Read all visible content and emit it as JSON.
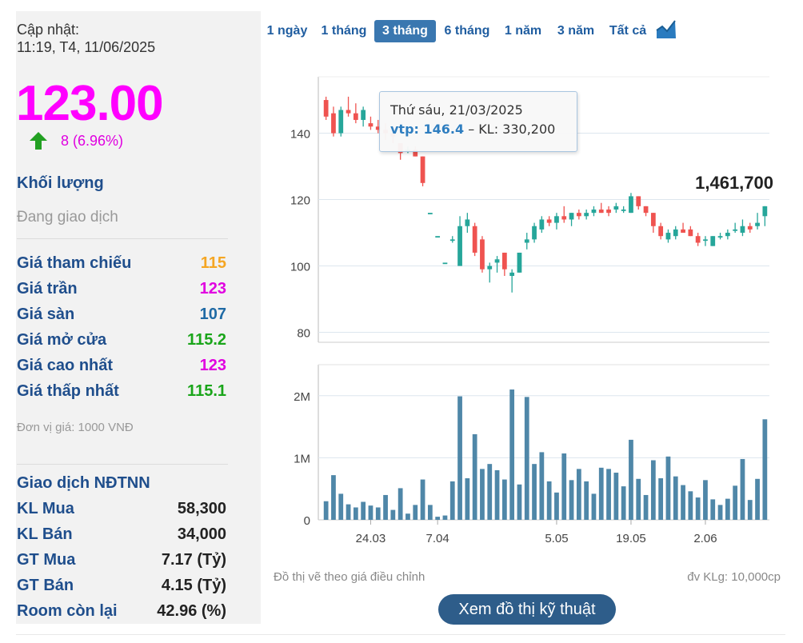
{
  "update": {
    "label": "Cập nhật:",
    "time": "11:19, T4, 11/06/2025"
  },
  "price": "123.00",
  "change": "8 (6.96%)",
  "volume": {
    "label": "Khối lượng",
    "value": "1,461,700"
  },
  "status": "Đang giao dịch",
  "prices": [
    {
      "label": "Giá tham chiếu",
      "value": "115",
      "color": "#f5a623"
    },
    {
      "label": "Giá trần",
      "value": "123",
      "color": "#e000e0"
    },
    {
      "label": "Giá sàn",
      "value": "107",
      "color": "#1f6aa5"
    },
    {
      "label": "Giá mở cửa",
      "value": "115.2",
      "color": "#1aa51a"
    },
    {
      "label": "Giá cao nhất",
      "value": "123",
      "color": "#e000e0"
    },
    {
      "label": "Giá thấp nhất",
      "value": "115.1",
      "color": "#1aa51a"
    }
  ],
  "unit_note": "Đơn vị giá: 1000 VNĐ",
  "foreign": {
    "title": "Giao dịch NĐTNN",
    "rows": [
      {
        "label": "KL Mua",
        "value": "58,300"
      },
      {
        "label": "KL Bán",
        "value": "34,000"
      },
      {
        "label": "GT Mua",
        "value": "7.17 (Tỷ)"
      },
      {
        "label": "GT Bán",
        "value": "4.15 (Tỷ)"
      },
      {
        "label": "Room còn lại",
        "value": "42.96 (%)"
      }
    ]
  },
  "tabs": [
    "1 ngày",
    "1 tháng",
    "3 tháng",
    "6 tháng",
    "1 năm",
    "3 năm",
    "Tất cả"
  ],
  "active_tab": "3 tháng",
  "tooltip": {
    "date": "Thứ sáu, 21/03/2025",
    "sym": "vtp:",
    "price": "146.4",
    "rest": " – KL: 330,200"
  },
  "footer_left": "Đồ thị vẽ theo giá điều chỉnh",
  "footer_right": "đv KLg: 10,000cp",
  "ta_button": "Xem đồ thị kỹ thuật",
  "chart_data": {
    "type": "candlestick",
    "price_axis": {
      "ticks": [
        80,
        100,
        120,
        140
      ],
      "range": [
        77,
        157
      ]
    },
    "volume_axis": {
      "ticks": [
        "0",
        "1M",
        "2M"
      ],
      "tick_values": [
        0,
        1000000,
        2000000
      ],
      "max": 2500000
    },
    "x_tick_labels": [
      {
        "label": "24.03",
        "index": 6
      },
      {
        "label": "7.04",
        "index": 15
      },
      {
        "label": "5.05",
        "index": 31
      },
      {
        "label": "19.05",
        "index": 41
      },
      {
        "label": "2.06",
        "index": 51
      }
    ],
    "up_color": "#26a69a",
    "down_color": "#ef5350",
    "volume_color": "#4f87a8",
    "candles": [
      {
        "o": 150,
        "h": 151,
        "l": 144,
        "c": 145,
        "v": 300000
      },
      {
        "o": 146,
        "h": 148,
        "l": 139,
        "c": 140,
        "v": 720000
      },
      {
        "o": 140,
        "h": 148,
        "l": 139,
        "c": 147,
        "v": 420000
      },
      {
        "o": 147,
        "h": 151,
        "l": 145,
        "c": 146,
        "v": 250000
      },
      {
        "o": 146,
        "h": 149,
        "l": 143,
        "c": 144,
        "v": 200000
      },
      {
        "o": 144,
        "h": 148,
        "l": 142,
        "c": 147,
        "v": 290000
      },
      {
        "o": 143,
        "h": 145,
        "l": 141,
        "c": 142,
        "v": 230000
      },
      {
        "o": 142,
        "h": 144,
        "l": 140,
        "c": 141,
        "v": 200000
      },
      {
        "o": 141,
        "h": 143,
        "l": 138,
        "c": 140,
        "v": 400000
      },
      {
        "o": 140,
        "h": 142,
        "l": 137,
        "c": 139,
        "v": 160000
      },
      {
        "o": 137,
        "h": 137,
        "l": 132,
        "c": 134,
        "v": 510000
      },
      {
        "o": 135,
        "h": 136,
        "l": 134,
        "c": 135,
        "v": 100000
      },
      {
        "o": 135,
        "h": 136,
        "l": 133,
        "c": 133,
        "v": 240000
      },
      {
        "o": 133,
        "h": 133,
        "l": 124,
        "c": 125,
        "v": 650000
      },
      {
        "o": 116,
        "h": 116,
        "l": 116,
        "c": 116,
        "v": 240000
      },
      {
        "o": 109,
        "h": 109,
        "l": 109,
        "c": 109,
        "v": 50000
      },
      {
        "o": 101,
        "h": 101,
        "l": 101,
        "c": 101,
        "v": 70000
      },
      {
        "o": 108,
        "h": 109,
        "l": 107,
        "c": 108,
        "v": 620000
      },
      {
        "o": 100,
        "h": 115,
        "l": 100,
        "c": 112,
        "v": 1990000
      },
      {
        "o": 112,
        "h": 116,
        "l": 110,
        "c": 114,
        "v": 670000
      },
      {
        "o": 112,
        "h": 113,
        "l": 103,
        "c": 104,
        "v": 1380000
      },
      {
        "o": 108,
        "h": 109,
        "l": 98,
        "c": 99,
        "v": 820000
      },
      {
        "o": 99,
        "h": 101,
        "l": 95,
        "c": 100,
        "v": 900000
      },
      {
        "o": 101,
        "h": 103,
        "l": 98,
        "c": 102,
        "v": 800000
      },
      {
        "o": 104,
        "h": 104,
        "l": 97,
        "c": 99,
        "v": 650000
      },
      {
        "o": 97,
        "h": 99,
        "l": 92,
        "c": 98,
        "v": 2100000
      },
      {
        "o": 98,
        "h": 104,
        "l": 98,
        "c": 104,
        "v": 570000
      },
      {
        "o": 107,
        "h": 110,
        "l": 105,
        "c": 108,
        "v": 1980000
      },
      {
        "o": 108,
        "h": 113,
        "l": 107,
        "c": 112,
        "v": 900000
      },
      {
        "o": 111,
        "h": 115,
        "l": 110,
        "c": 114,
        "v": 1090000
      },
      {
        "o": 114,
        "h": 115,
        "l": 112,
        "c": 113,
        "v": 620000
      },
      {
        "o": 113,
        "h": 116,
        "l": 111,
        "c": 115,
        "v": 440000
      },
      {
        "o": 115,
        "h": 118,
        "l": 113,
        "c": 114,
        "v": 1070000
      },
      {
        "o": 114,
        "h": 116,
        "l": 112,
        "c": 116,
        "v": 640000
      },
      {
        "o": 116,
        "h": 117,
        "l": 114,
        "c": 115,
        "v": 820000
      },
      {
        "o": 115,
        "h": 117,
        "l": 114,
        "c": 116,
        "v": 620000
      },
      {
        "o": 116,
        "h": 118,
        "l": 115,
        "c": 117,
        "v": 420000
      },
      {
        "o": 117,
        "h": 119,
        "l": 116,
        "c": 116,
        "v": 840000
      },
      {
        "o": 117,
        "h": 118,
        "l": 115,
        "c": 116,
        "v": 820000
      },
      {
        "o": 117,
        "h": 119,
        "l": 116,
        "c": 118,
        "v": 760000
      },
      {
        "o": 117,
        "h": 118,
        "l": 116,
        "c": 117,
        "v": 540000
      },
      {
        "o": 116,
        "h": 122,
        "l": 116,
        "c": 121,
        "v": 1290000
      },
      {
        "o": 121,
        "h": 121,
        "l": 117,
        "c": 118,
        "v": 660000
      },
      {
        "o": 118,
        "h": 118,
        "l": 115,
        "c": 116,
        "v": 400000
      },
      {
        "o": 116,
        "h": 116,
        "l": 110,
        "c": 112,
        "v": 960000
      },
      {
        "o": 112,
        "h": 113,
        "l": 108,
        "c": 109,
        "v": 670000
      },
      {
        "o": 108,
        "h": 111,
        "l": 107,
        "c": 110,
        "v": 1020000
      },
      {
        "o": 109,
        "h": 112,
        "l": 108,
        "c": 111,
        "v": 700000
      },
      {
        "o": 111,
        "h": 113,
        "l": 110,
        "c": 110,
        "v": 560000
      },
      {
        "o": 111,
        "h": 112,
        "l": 109,
        "c": 109,
        "v": 460000
      },
      {
        "o": 109,
        "h": 110,
        "l": 106,
        "c": 107,
        "v": 360000
      },
      {
        "o": 108,
        "h": 109,
        "l": 106,
        "c": 108,
        "v": 640000
      },
      {
        "o": 106,
        "h": 109,
        "l": 106,
        "c": 109,
        "v": 330000
      },
      {
        "o": 109,
        "h": 110,
        "l": 108,
        "c": 109,
        "v": 240000
      },
      {
        "o": 109,
        "h": 111,
        "l": 108,
        "c": 110,
        "v": 340000
      },
      {
        "o": 111,
        "h": 113,
        "l": 110,
        "c": 111,
        "v": 550000
      },
      {
        "o": 110,
        "h": 114,
        "l": 109,
        "c": 112,
        "v": 980000
      },
      {
        "o": 112,
        "h": 113,
        "l": 110,
        "c": 111,
        "v": 320000
      },
      {
        "o": 112,
        "h": 116,
        "l": 111,
        "c": 113,
        "v": 660000
      },
      {
        "o": 115,
        "h": 118,
        "l": 112,
        "c": 118,
        "v": 1620000
      }
    ]
  }
}
